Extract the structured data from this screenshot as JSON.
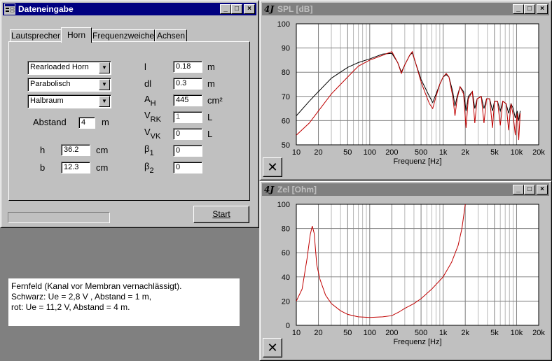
{
  "dialog": {
    "title": "Dateneingabe",
    "tabs": [
      "Lautsprecher",
      "Horn",
      "Frequenzweiche",
      "Achsen"
    ],
    "selected_tab": "Horn",
    "combos": [
      "Rearloaded Horn",
      "Parabolisch",
      "Halbraum"
    ],
    "abstand_label": "Abstand",
    "abstand_value": "4",
    "abstand_unit": "m",
    "h_label": "h",
    "h_value": "36.2",
    "h_unit": "cm",
    "b_label": "b",
    "b_value": "12.3",
    "b_unit": "cm",
    "params": [
      {
        "label": "l",
        "sub": "",
        "value": "0.18",
        "unit": "m",
        "disabled": false
      },
      {
        "label": "dl",
        "sub": "",
        "value": "0.3",
        "unit": "m",
        "disabled": false
      },
      {
        "label": "A",
        "sub": "H",
        "value": "445",
        "unit": "cm²",
        "disabled": false
      },
      {
        "label": "V",
        "sub": "RK",
        "value": "1",
        "unit": "L",
        "disabled": true
      },
      {
        "label": "V",
        "sub": "VK",
        "value": "0",
        "unit": "L",
        "disabled": false
      },
      {
        "label": "β",
        "sub": "1",
        "value": "0",
        "unit": "",
        "disabled": false
      },
      {
        "label": "β",
        "sub": "2",
        "value": "0",
        "unit": "",
        "disabled": false
      }
    ],
    "start_label": "Start"
  },
  "note": {
    "lines": [
      "Fernfeld (Kanal vor Membran vernachlässigt).",
      "Schwarz: Ue = 2,8 V , Abstand = 1 m,",
      "rot: Ue = 11,2 V, Abstand = 4 m."
    ]
  },
  "colors": {
    "title_active": "#000080",
    "title_inactive": "#808080",
    "red": "#c00000",
    "black": "#000000"
  },
  "chart_data": [
    {
      "type": "line",
      "title": "SPL [dB]",
      "xlabel": "Frequenz [Hz]",
      "ylabel": "",
      "x_scale": "log",
      "xlim": [
        10,
        20000
      ],
      "ylim": [
        50,
        100
      ],
      "x_ticks": [
        10,
        20,
        50,
        100,
        200,
        500,
        1000,
        2000,
        5000,
        10000,
        20000
      ],
      "x_tick_labels": [
        "10",
        "20",
        "50",
        "100",
        "200",
        "500",
        "1k",
        "2k",
        "5k",
        "10k",
        "20k"
      ],
      "y_ticks": [
        50,
        60,
        70,
        80,
        90,
        100
      ],
      "grid": true,
      "series": [
        {
          "color": "black",
          "points": [
            [
              10,
              62
            ],
            [
              15,
              68
            ],
            [
              20,
              72
            ],
            [
              30,
              77.5
            ],
            [
              50,
              82
            ],
            [
              70,
              84
            ],
            [
              100,
              85.5
            ],
            [
              150,
              87.5
            ],
            [
              200,
              87.8
            ],
            [
              240,
              84
            ],
            [
              270,
              80
            ],
            [
              300,
              83
            ],
            [
              350,
              87
            ],
            [
              380,
              88
            ],
            [
              420,
              84
            ],
            [
              500,
              77
            ],
            [
              560,
              74
            ],
            [
              650,
              70
            ],
            [
              720,
              67.5
            ],
            [
              800,
              71
            ],
            [
              900,
              75
            ],
            [
              1000,
              78
            ],
            [
              1100,
              79
            ],
            [
              1200,
              78
            ],
            [
              1350,
              72
            ],
            [
              1450,
              66
            ],
            [
              1550,
              70
            ],
            [
              1700,
              74
            ],
            [
              1900,
              72
            ],
            [
              2050,
              64
            ],
            [
              2200,
              70
            ],
            [
              2500,
              72
            ],
            [
              2700,
              65
            ],
            [
              2900,
              69
            ],
            [
              3300,
              70
            ],
            [
              3600,
              65
            ],
            [
              3900,
              69
            ],
            [
              4300,
              69
            ],
            [
              4700,
              64
            ],
            [
              5000,
              68
            ],
            [
              5500,
              68
            ],
            [
              6000,
              64
            ],
            [
              6500,
              68
            ],
            [
              7200,
              67
            ],
            [
              7800,
              63
            ],
            [
              8400,
              67
            ],
            [
              9000,
              65
            ],
            [
              9600,
              61
            ],
            [
              10200,
              64
            ],
            [
              10700,
              60
            ],
            [
              11200,
              64
            ]
          ]
        },
        {
          "color": "red",
          "points": [
            [
              10,
              54
            ],
            [
              15,
              59
            ],
            [
              20,
              64
            ],
            [
              30,
              71
            ],
            [
              50,
              78
            ],
            [
              70,
              82.5
            ],
            [
              100,
              85
            ],
            [
              150,
              87
            ],
            [
              200,
              88.5
            ],
            [
              240,
              84
            ],
            [
              270,
              79.5
            ],
            [
              300,
              83
            ],
            [
              350,
              87
            ],
            [
              380,
              88.5
            ],
            [
              420,
              84
            ],
            [
              500,
              76
            ],
            [
              560,
              72
            ],
            [
              650,
              67
            ],
            [
              720,
              65
            ],
            [
              800,
              70
            ],
            [
              900,
              75
            ],
            [
              1000,
              78
            ],
            [
              1100,
              79.5
            ],
            [
              1200,
              78
            ],
            [
              1350,
              70
            ],
            [
              1450,
              62
            ],
            [
              1550,
              69
            ],
            [
              1700,
              74
            ],
            [
              1900,
              71
            ],
            [
              2050,
              57
            ],
            [
              2200,
              69
            ],
            [
              2500,
              72
            ],
            [
              2700,
              59
            ],
            [
              2900,
              69
            ],
            [
              3300,
              70
            ],
            [
              3600,
              59
            ],
            [
              3900,
              69
            ],
            [
              4300,
              69
            ],
            [
              4700,
              57
            ],
            [
              5000,
              68
            ],
            [
              5500,
              68
            ],
            [
              6000,
              58
            ],
            [
              6500,
              68
            ],
            [
              7200,
              67
            ],
            [
              7800,
              56
            ],
            [
              8400,
              67
            ],
            [
              9000,
              62
            ],
            [
              9600,
              54
            ],
            [
              10200,
              63
            ],
            [
              10700,
              52
            ],
            [
              11200,
              63
            ]
          ]
        }
      ]
    },
    {
      "type": "line",
      "title": "Zel [Ohm]",
      "xlabel": "Frequenz [Hz]",
      "ylabel": "",
      "x_scale": "log",
      "xlim": [
        10,
        20000
      ],
      "ylim": [
        0,
        100
      ],
      "x_ticks": [
        10,
        20,
        50,
        100,
        200,
        500,
        1000,
        2000,
        5000,
        10000,
        20000
      ],
      "x_tick_labels": [
        "10",
        "20",
        "50",
        "100",
        "200",
        "500",
        "1k",
        "2k",
        "5k",
        "10k",
        "20k"
      ],
      "y_ticks": [
        0,
        20,
        40,
        60,
        80,
        100
      ],
      "grid": true,
      "series": [
        {
          "color": "red",
          "points": [
            [
              10,
              20
            ],
            [
              12,
              30
            ],
            [
              14,
              55
            ],
            [
              15.5,
              75
            ],
            [
              16.5,
              82
            ],
            [
              17.5,
              76
            ],
            [
              19,
              50
            ],
            [
              21,
              38
            ],
            [
              25,
              25
            ],
            [
              30,
              18
            ],
            [
              40,
              12
            ],
            [
              50,
              9
            ],
            [
              70,
              7
            ],
            [
              100,
              6.5
            ],
            [
              150,
              7
            ],
            [
              200,
              8
            ],
            [
              250,
              11
            ],
            [
              300,
              14
            ],
            [
              400,
              18
            ],
            [
              500,
              22
            ],
            [
              700,
              30
            ],
            [
              1000,
              40
            ],
            [
              1300,
              52
            ],
            [
              1600,
              66
            ],
            [
              1800,
              80
            ],
            [
              2000,
              100
            ]
          ]
        }
      ]
    }
  ],
  "spl_window": {
    "title": "SPL [dB]",
    "icon": "4J"
  },
  "zel_window": {
    "title": "Zel [Ohm]",
    "icon": "4J"
  },
  "window_buttons": {
    "min": "_",
    "max": "□",
    "close": "×"
  },
  "tool_button": "✕"
}
